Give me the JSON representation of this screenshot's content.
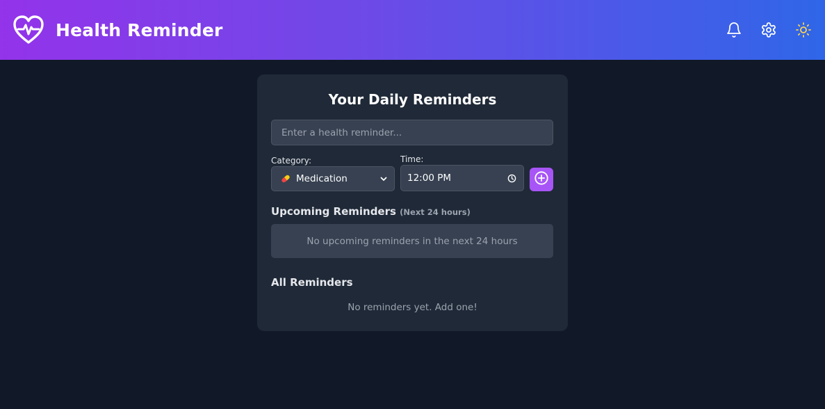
{
  "header": {
    "title": "Health Reminder",
    "logo_icon": "heart-pulse-icon",
    "actions": [
      {
        "name": "notifications",
        "icon": "bell-icon"
      },
      {
        "name": "settings",
        "icon": "gear-icon"
      },
      {
        "name": "theme-toggle",
        "icon": "sun-icon"
      }
    ],
    "gradient": [
      "#9333ea",
      "#2f66e8"
    ]
  },
  "card": {
    "title": "Your Daily Reminders",
    "reminder_input": {
      "value": "",
      "placeholder": "Enter a health reminder..."
    },
    "category": {
      "label": "Category:",
      "selected": "Medication",
      "icon": "pill-icon"
    },
    "time": {
      "label": "Time:",
      "value": "12:00 PM",
      "icon": "clock-icon"
    },
    "add_button": {
      "icon": "plus-circle-icon",
      "color": "#a855f7"
    },
    "upcoming": {
      "title": "Upcoming Reminders",
      "subtitle": "(Next 24 hours)",
      "empty_text": "No upcoming reminders in the next 24 hours"
    },
    "all": {
      "title": "All Reminders",
      "empty_text": "No reminders yet. Add one!"
    }
  },
  "colors": {
    "background": "#111827",
    "card": "#1f2937",
    "input": "#374151",
    "accent": "#a855f7"
  }
}
